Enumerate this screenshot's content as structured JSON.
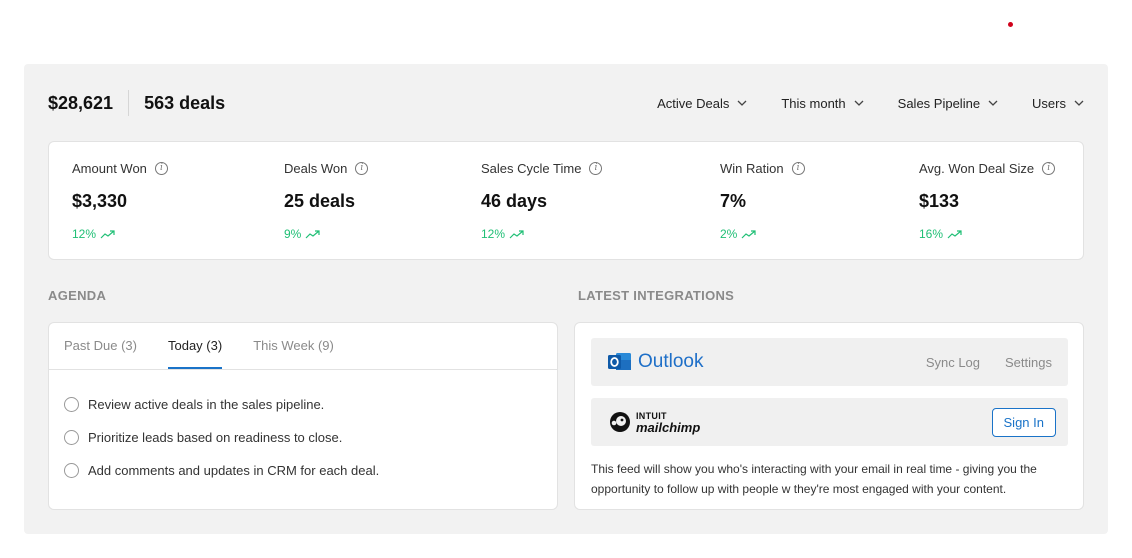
{
  "header": {
    "amount": "$28,621",
    "deals": "563 deals",
    "filters": [
      {
        "label": "Active Deals"
      },
      {
        "label": "This month"
      },
      {
        "label": "Sales Pipeline"
      },
      {
        "label": "Users"
      }
    ]
  },
  "stats": [
    {
      "label": "Amount Won",
      "value": "$3,330",
      "change": "12%"
    },
    {
      "label": "Deals Won",
      "value": "25 deals",
      "change": "9%"
    },
    {
      "label": "Sales Cycle Time",
      "value": "46 days",
      "change": "12%"
    },
    {
      "label": "Win Ration",
      "value": "7%",
      "change": "2%"
    },
    {
      "label": "Avg. Won Deal Size",
      "value": "$133",
      "change": "16%"
    }
  ],
  "agenda": {
    "title": "AGENDA",
    "tabs": [
      {
        "label": "Past Due (3)"
      },
      {
        "label": "Today (3)"
      },
      {
        "label": "This Week (9)"
      }
    ],
    "active_tab": "Today (3)",
    "tasks": [
      {
        "text": "Review active deals in the sales pipeline."
      },
      {
        "text": "Prioritize leads based on readiness to close."
      },
      {
        "text": "Add comments and updates in CRM for each deal."
      }
    ]
  },
  "integrations": {
    "title": "LATEST INTEGRATIONS",
    "outlook": {
      "name": "Outlook",
      "sync_log": "Sync Log",
      "settings": "Settings"
    },
    "mailchimp": {
      "brand_top": "INTUIT",
      "brand_name": "mailchimp",
      "sign_in": "Sign In"
    },
    "feed_text": "This feed will show you who's interacting with your email in real time - giving you the opportunity to follow up with people w they're most engaged with your content."
  },
  "colors": {
    "accent": "#1a73c8",
    "positive": "#1fbf75",
    "panel_bg": "#f2f2f2",
    "indicator": "#d0021b"
  }
}
